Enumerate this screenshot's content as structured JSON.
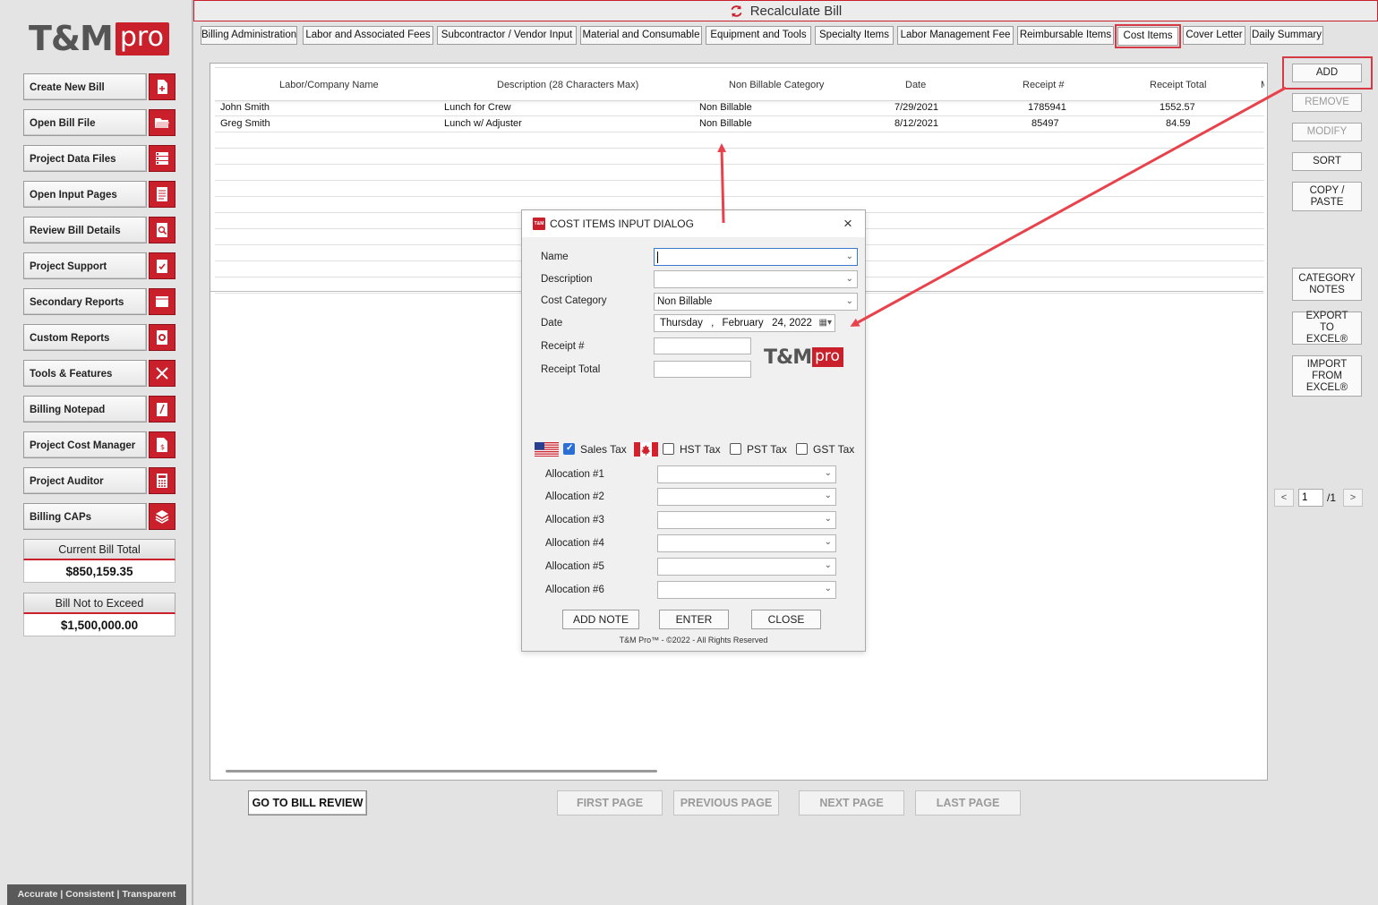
{
  "app": {
    "recalc_label": "Recalculate Bill",
    "logo_tm": "T&M",
    "logo_pro": "pro",
    "tagline": "Accurate | Consistent | Transparent",
    "accent_color": "#c9202c"
  },
  "sidebar": {
    "items": [
      {
        "label": "Create New Bill",
        "icon": "new-document-icon"
      },
      {
        "label": "Open Bill File",
        "icon": "folder-open-icon"
      },
      {
        "label": "Project Data Files",
        "icon": "data-list-icon"
      },
      {
        "label": "Open Input Pages",
        "icon": "input-pages-icon"
      },
      {
        "label": "Review Bill Details",
        "icon": "magnify-document-icon"
      },
      {
        "label": "Project Support",
        "icon": "checklist-icon"
      },
      {
        "label": "Secondary Reports",
        "icon": "report-icon"
      },
      {
        "label": "Custom Reports",
        "icon": "custom-report-icon"
      },
      {
        "label": "Tools & Features",
        "icon": "tools-icon"
      },
      {
        "label": "Billing Notepad",
        "icon": "notepad-icon"
      },
      {
        "label": "Project Cost Manager",
        "icon": "cost-document-icon"
      },
      {
        "label": "Project Auditor",
        "icon": "calculator-icon"
      },
      {
        "label": "Billing CAPs",
        "icon": "layers-icon"
      }
    ],
    "current_total_label": "Current Bill Total",
    "current_total_value": "$850,159.35",
    "not_exceed_label": "Bill Not to Exceed",
    "not_exceed_value": "$1,500,000.00"
  },
  "tabs": [
    {
      "label": "Billing Administration",
      "active": false
    },
    {
      "label": "Labor and Associated Fees",
      "active": false
    },
    {
      "label": "Subcontractor / Vendor Input",
      "active": false
    },
    {
      "label": "Material and Consumable",
      "active": false
    },
    {
      "label": "Equipment and Tools",
      "active": false
    },
    {
      "label": "Specialty Items",
      "active": false
    },
    {
      "label": "Labor Management Fee",
      "active": false
    },
    {
      "label": "Reimbursable Items",
      "active": false
    },
    {
      "label": "Cost Items",
      "active": true
    },
    {
      "label": "Cover Letter",
      "active": false
    },
    {
      "label": "Daily Summary",
      "active": false
    }
  ],
  "table": {
    "columns": [
      "Labor/Company Name",
      "Description (28 Characters Max)",
      "Non Billable Category",
      "Date",
      "Receipt #",
      "Receipt Total",
      "M"
    ],
    "rows": [
      {
        "name": "John Smith",
        "description": "Lunch for Crew",
        "category": "Non Billable",
        "date": "7/29/2021",
        "receipt": "1785941",
        "total": "1552.57"
      },
      {
        "name": "Greg Smith",
        "description": "Lunch w/ Adjuster",
        "category": "Non Billable",
        "date": "8/12/2021",
        "receipt": "85497",
        "total": "84.59"
      }
    ]
  },
  "actions": {
    "add": "ADD",
    "remove": "REMOVE",
    "modify": "MODIFY",
    "sort": "SORT",
    "copy_paste": "COPY / PASTE",
    "category_notes": "CATEGORY NOTES",
    "export_excel": "EXPORT TO EXCEL®",
    "import_excel": "IMPORT FROM EXCEL®"
  },
  "pager": {
    "prev": "<",
    "next": ">",
    "current": "1",
    "total": "/1"
  },
  "bottom_nav": {
    "go_review": "GO TO BILL REVIEW",
    "first": "FIRST PAGE",
    "previous": "PREVIOUS PAGE",
    "next": "NEXT PAGE",
    "last": "LAST PAGE"
  },
  "dialog": {
    "title": "COST ITEMS INPUT DIALOG",
    "close_icon": "×",
    "labels": {
      "name": "Name",
      "description": "Description",
      "cost_category": "Cost Category",
      "date": "Date",
      "receipt_num": "Receipt #",
      "receipt_total": "Receipt Total"
    },
    "values": {
      "name": "",
      "description": "",
      "cost_category": "Non Billable",
      "date_day": "Thursday",
      "date_sep": ",",
      "date_month_day_year": "February   24, 2022"
    },
    "taxes": {
      "sales": {
        "label": "Sales Tax",
        "checked": true
      },
      "hst": {
        "label": "HST Tax",
        "checked": false
      },
      "pst": {
        "label": "PST Tax",
        "checked": false
      },
      "gst": {
        "label": "GST Tax",
        "checked": false
      }
    },
    "allocations": [
      "Allocation #1",
      "Allocation #2",
      "Allocation #3",
      "Allocation #4",
      "Allocation #5",
      "Allocation #6"
    ],
    "buttons": {
      "add_note": "ADD NOTE",
      "enter": "ENTER",
      "close": "CLOSE"
    },
    "footer": "T&M Pro™ - ©2022 - All Rights Reserved"
  }
}
